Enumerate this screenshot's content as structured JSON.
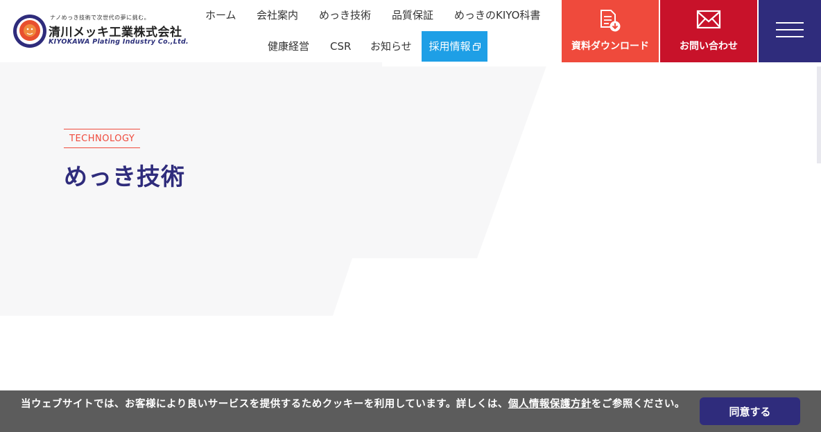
{
  "header": {
    "logo": {
      "tagline": "ナノめっき技術で次世代の夢に挑む。",
      "company_name": "清川メッキ工業株式会社",
      "company_name_en": "KIYOKAWA Plating Industry Co.,Ltd."
    },
    "nav_row1": [
      {
        "label": "ホーム"
      },
      {
        "label": "会社案内"
      },
      {
        "label": "めっき技術"
      },
      {
        "label": "品質保証"
      },
      {
        "label": "めっきのKIYO科書"
      }
    ],
    "nav_row2": [
      {
        "label": "健康経営"
      },
      {
        "label": "CSR"
      },
      {
        "label": "お知らせ"
      }
    ],
    "recruit_label": "採用情報",
    "document_download_label": "資料ダウンロード",
    "contact_label": "お問い合わせ",
    "colors": {
      "navy": "#2f2c7c",
      "red_orange": "#ef4a3c",
      "crimson": "#c8122a",
      "sky_blue": "#1e9fe6"
    }
  },
  "hero": {
    "section_label_en": "TECHNOLOGY",
    "page_title": "めっき技術"
  },
  "cookie_banner": {
    "text_before": "当ウェブサイトでは、お客様により良いサービスを提供するためクッキーを利用しています。詳しくは、",
    "link_text": "個人情報保護方針",
    "text_after": "をご参照ください。",
    "accept_label": "同意する"
  }
}
